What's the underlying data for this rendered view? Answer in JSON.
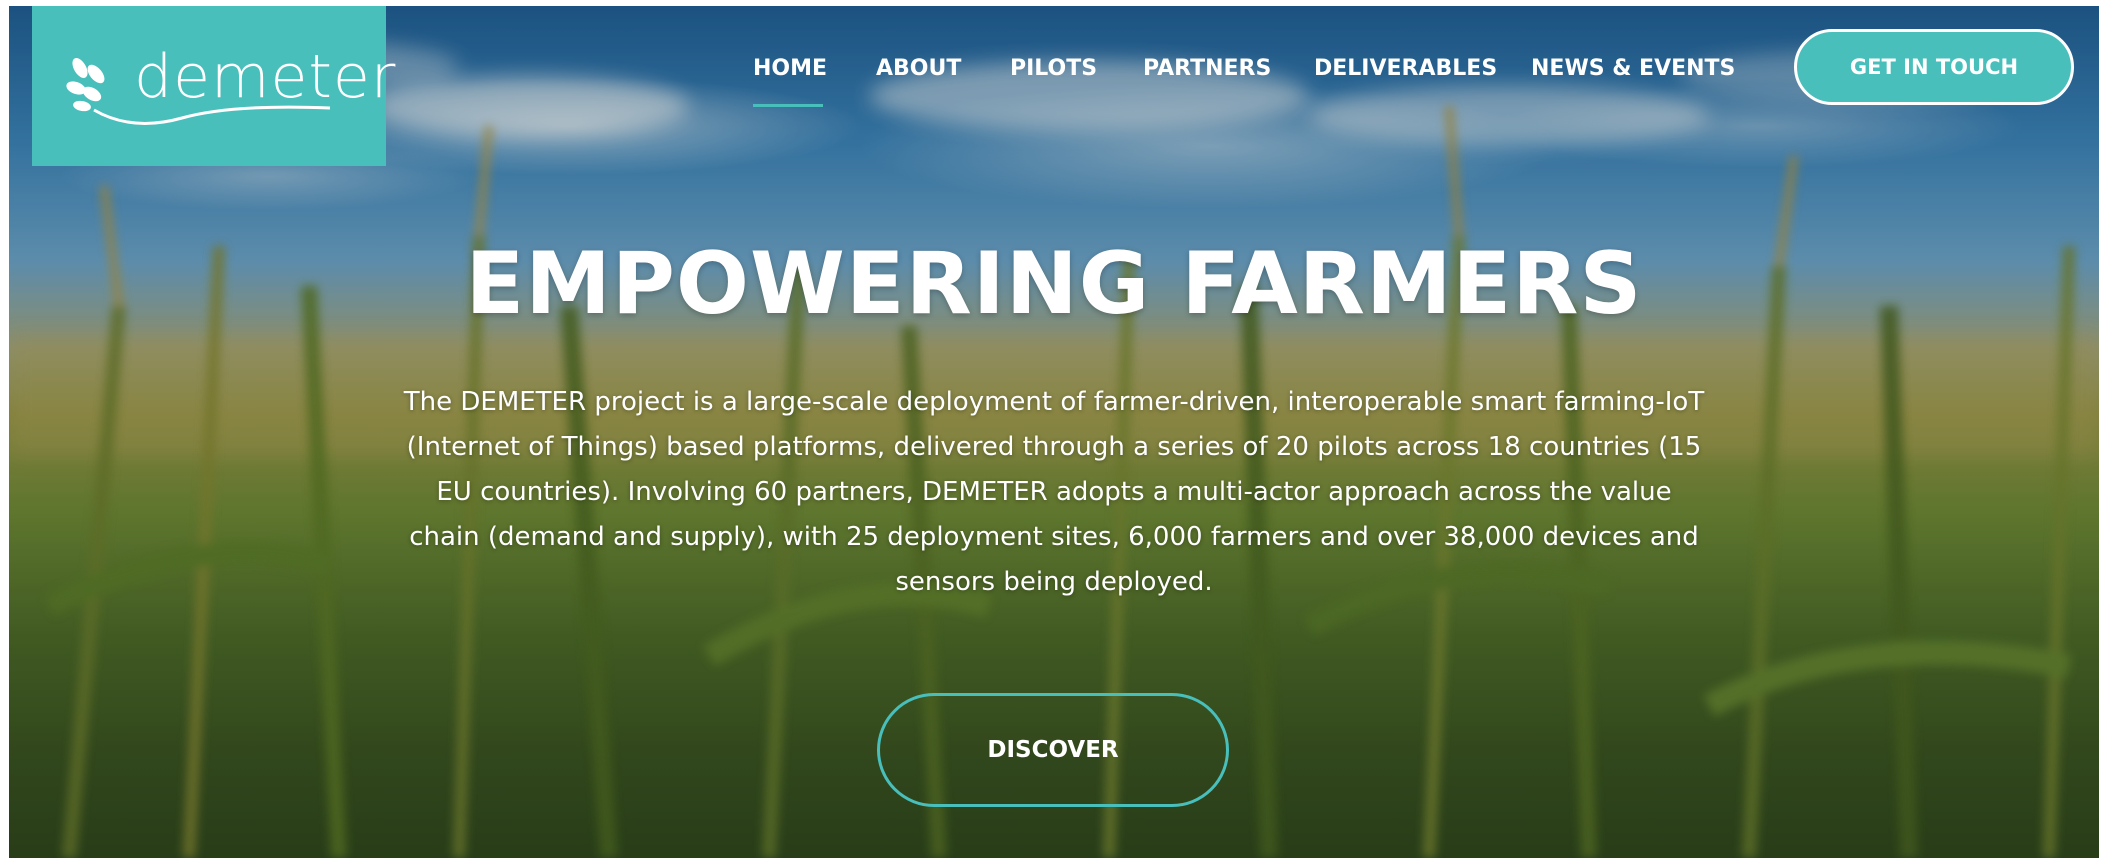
{
  "brand": {
    "logo_text": "demeter",
    "accent_color": "#49bfbc"
  },
  "nav": {
    "items": [
      {
        "label": "HOME",
        "active": true
      },
      {
        "label": "ABOUT"
      },
      {
        "label": "PILOTS"
      },
      {
        "label": "PARTNERS"
      },
      {
        "label": "DELIVERABLES"
      },
      {
        "label": "NEWS & EVENTS"
      }
    ],
    "cta_label": "GET IN TOUCH"
  },
  "hero": {
    "title": "EMPOWERING FARMERS",
    "description": "The DEMETER project is a large-scale deployment of farmer-driven, interoperable smart farming-IoT (Internet of Things) based platforms, delivered through a series of 20 pilots across 18 countries (15 EU countries). Involving 60 partners, DEMETER adopts a multi-actor approach across the value chain (demand and supply), with 25 deployment sites, 6,000 farmers and over 38,000 devices and sensors being deployed.",
    "button_label": "DISCOVER"
  },
  "icons": {
    "logo_icon": "wheat-leaf-icon"
  }
}
